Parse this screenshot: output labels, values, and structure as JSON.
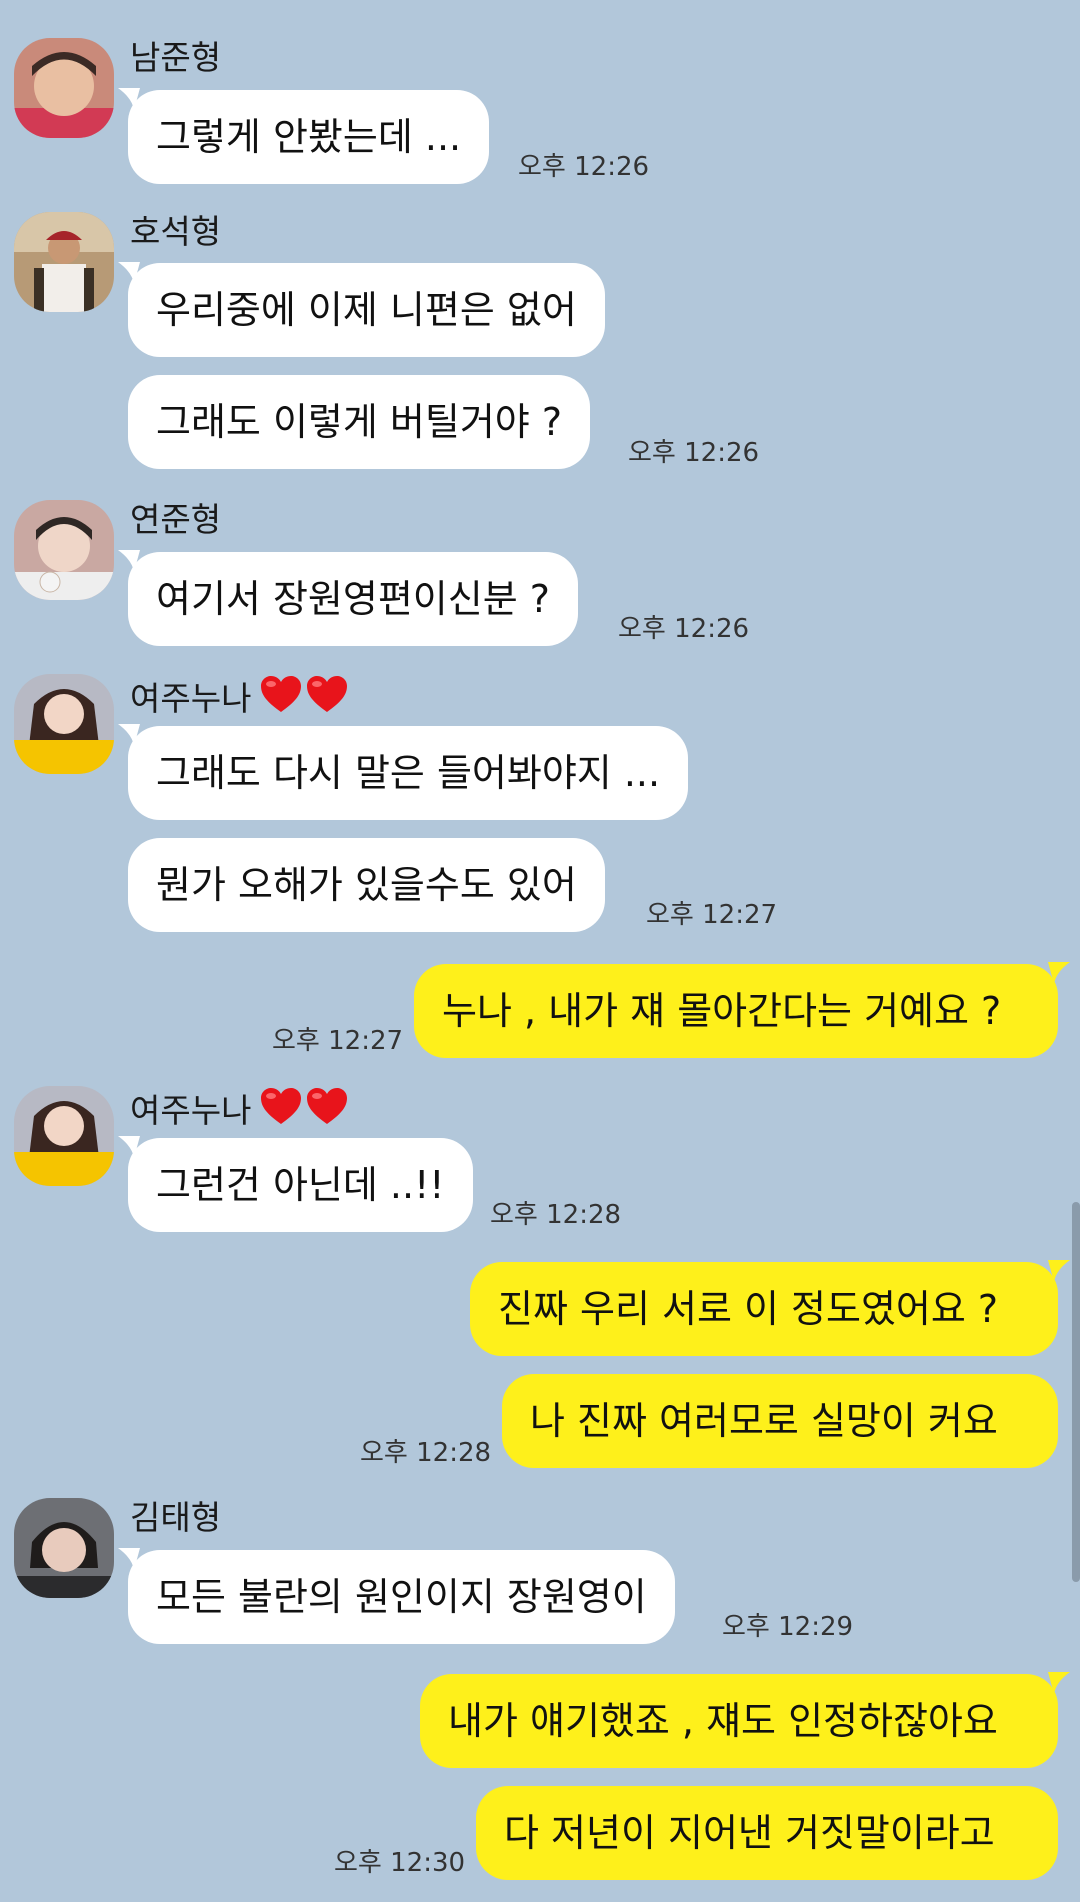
{
  "colors": {
    "background": "#b2c7da",
    "incoming_bubble": "#ffffff",
    "outgoing_bubble": "#fef01b",
    "heart": "#e8141b"
  },
  "messages": [
    {
      "sender": "남준형",
      "text": "그렇게 안봤는데 ...",
      "time": "오후 12:26"
    },
    {
      "sender": "호석형",
      "text": "우리중에 이제 니편은 없어"
    },
    {
      "text": "그래도 이렇게 버틸거야 ?",
      "time": "오후 12:26"
    },
    {
      "sender": "연준형",
      "text": "여기서 장원영편이신분 ?",
      "time": "오후 12:26"
    },
    {
      "sender": "여주누나",
      "text": "그래도 다시 말은 들어봐야지 ..."
    },
    {
      "text": "뭔가 오해가 있을수도 있어",
      "time": "오후 12:27"
    },
    {
      "text": "누나 , 내가 쟤 몰아간다는 거예요 ?",
      "time": "오후 12:27"
    },
    {
      "sender": "여주누나",
      "text": "그런건 아닌데 ..!!",
      "time": "오후 12:28"
    },
    {
      "text": "진짜 우리 서로 이 정도였어요 ?"
    },
    {
      "text": "나 진짜 여러모로 실망이 커요",
      "time": "오후 12:28"
    },
    {
      "sender": "김태형",
      "text": "모든 불란의 원인이지 장원영이",
      "time": "오후 12:29"
    },
    {
      "text": "내가 얘기했죠 , 쟤도 인정하잖아요"
    },
    {
      "text": "다 저년이 지어낸 거짓말이라고",
      "time": "오후 12:30"
    }
  ]
}
